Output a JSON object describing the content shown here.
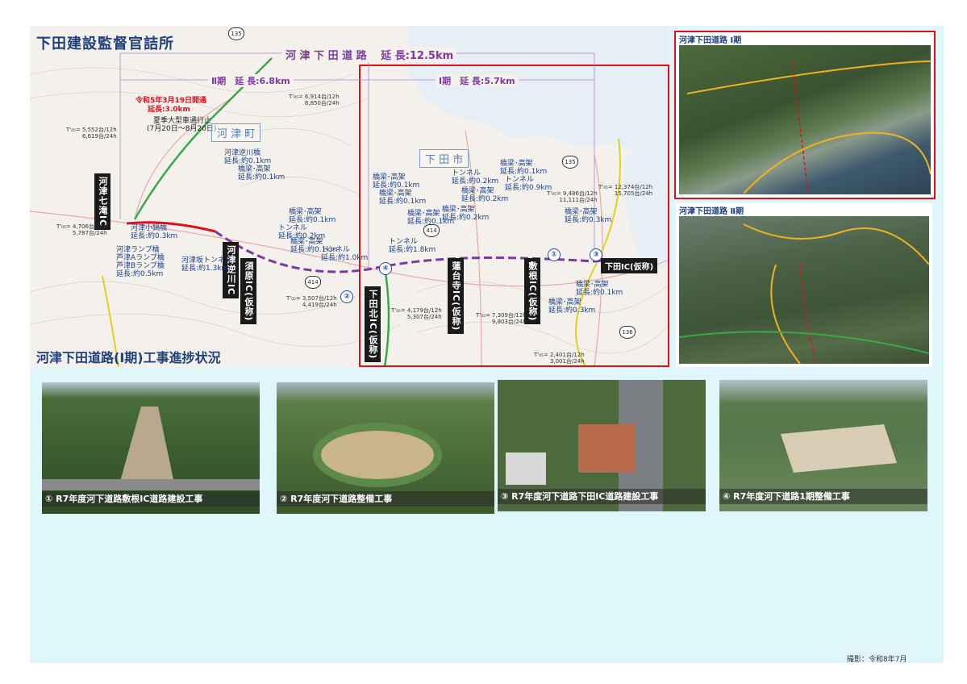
{
  "header": {
    "organization": "下田建設監督官詰所",
    "section_title": "河津下田道路(Ⅰ期)工事進捗状況"
  },
  "map": {
    "spans": {
      "total": "河 津 下 田 道 路　 延 長:12.5km",
      "phase2": "Ⅱ期　延 長:6.8km",
      "phase1": "Ⅰ期　延 長:5.7km"
    },
    "opening": {
      "line1": "令和5年3月19日開通",
      "line2": "延長:3.0km"
    },
    "detour": {
      "line1": "夏季大型車通行止",
      "line2": "(7月20日～8月20日)"
    },
    "towns": {
      "kawazu": "河 津 町",
      "shimoda": "下 田 市"
    },
    "interchanges": {
      "kawazu_nanadaru": "河津七滝IC",
      "kawazu_sakagawa": "河津逆川IC",
      "suhara": "須原IC(仮称)",
      "shimoda_kita": "下田北IC(仮称)",
      "rendaiji": "蓮台寺IC(仮称)",
      "shikine": "敷根IC(仮称)",
      "shimoda": "下田IC(仮称)"
    },
    "route_numbers": [
      "135",
      "414",
      "414",
      "135",
      "136"
    ],
    "markers": [
      "①",
      "②",
      "③",
      "④"
    ],
    "labels": [
      "河津小鍋橋\n延長:約0.3km",
      "河津ランプ橋\n芦津Aランプ橋\n芦津Bランプ橋\n延長:約0.5km",
      "河津逆川橋\n延長:約0.1km",
      "橋梁･高架\n延長:約0.1km",
      "橋梁･高架\n延長:約0.1km",
      "トンネル\n延長:約0.2km",
      "橋梁･高架\n延長:約0.1km",
      "河津坂トンネル\n延長:約1.3km",
      "トンネル\n延長:約1.0km",
      "橋梁･高架\n延長:約0.1km",
      "橋梁･高架\n延長:約0.1km",
      "橋梁･高架\n延長:約0.1km",
      "トンネル\n延長:約0.2km",
      "橋梁･高架\n延長:約0.2km",
      "トンネル\n延長:約1.8km",
      "橋梁･高架\n延長:約0.2km",
      "橋梁･高架\n延長:約0.1km",
      "トンネル\n延長:約0.9km",
      "橋梁･高架\n延長:約0.3km",
      "橋梁･高架\n延長:約0.1km",
      "橋梁･高架\n延長:約0.3km"
    ],
    "traffic_counts": [
      "T'₀₅= 6,914台/12h\n8,850台/24h",
      "T'₀₅= 5,552台/12h\n6,619台/24h",
      "T'₀₅= 4,706台/12h\n5,787台/24h",
      "T'₀₅= 3,507台/12h\n4,419台/24h",
      "T'₀₅= 4,179台/12h\n5,307台/24h",
      "T'₀₅= 7,309台/12h\n9,803台/24h",
      "T'₀₅= 9,486台/12h\n11,111台/24h",
      "T'₀₅= 12,374台/12h\n15,705台/24h",
      "T'₀₅= 2,401台/12h\n3,001台/24h"
    ]
  },
  "aerials": {
    "phase1_title": "河津下田道路 Ⅰ期",
    "phase2_title": "河津下田道路 Ⅱ期"
  },
  "photos": [
    {
      "caption": "① R7年度河下道路敷根IC道路建設工事"
    },
    {
      "caption": "② R7年度河下道路整備工事"
    },
    {
      "caption": "③ R7年度河下道路下田IC道路建設工事"
    },
    {
      "caption": "④ R7年度河下道路1期整備工事"
    }
  ],
  "credit": "撮影：令和8年7月",
  "colors": {
    "accent_red": "#e0101a",
    "route_purple": "#7a3aa0",
    "title_blue": "#1f3f7a",
    "panel_bg": "#dff6fb"
  }
}
